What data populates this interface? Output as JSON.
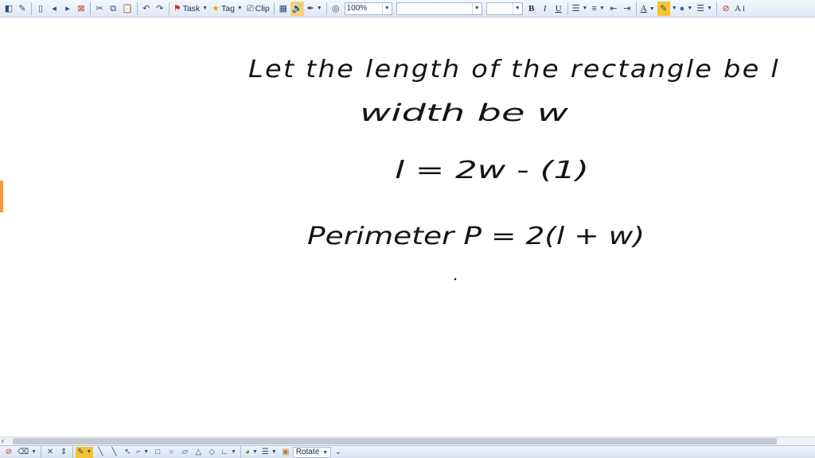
{
  "toolbar": {
    "task_label": "Task",
    "tag_label": "Tag",
    "clip_label": "Clip",
    "zoom_value": "100%",
    "font_name_value": "",
    "font_size_value": "",
    "bold_label": "B",
    "italic_label": "I",
    "underline_label": "U",
    "text_color_label": "A",
    "ai_label": "A",
    "accent_color": "#f4a033",
    "highlight_color": "#f4c430"
  },
  "notes": {
    "line1": "Let the length of the rectangle be l",
    "line2": "width be w",
    "line3": "l = 2w - (1)",
    "line4": "Perimeter P = 2(l + w)"
  },
  "bottom_toolbar": {
    "rotate_label": "Rotate"
  }
}
